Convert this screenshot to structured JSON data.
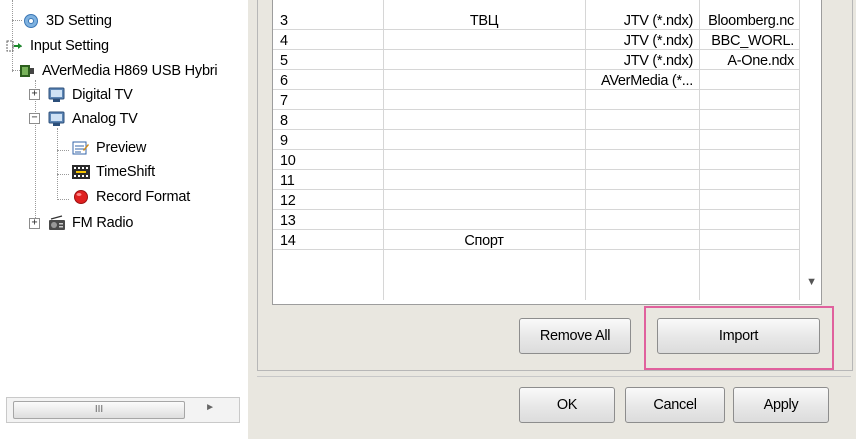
{
  "tree": {
    "items": [
      {
        "label": "3D Setting",
        "icon": "gear-icon"
      },
      {
        "label": "Input Setting",
        "icon": "input-icon"
      },
      {
        "label": "AVerMedia H869 USB Hybri",
        "icon": "tv-tuner-icon"
      },
      {
        "label": "Digital TV",
        "icon": "channel-icon",
        "expander": "+"
      },
      {
        "label": "Analog TV",
        "icon": "channel-icon",
        "expander": "−"
      },
      {
        "label": "Preview",
        "icon": "preview-icon"
      },
      {
        "label": "TimeShift",
        "icon": "timeshift-icon"
      },
      {
        "label": "Record Format",
        "icon": "record-icon"
      },
      {
        "label": "FM Radio",
        "icon": "radio-icon",
        "expander": "+"
      }
    ],
    "scrollbar_thumb": "III",
    "scroll_right_arrow": "►"
  },
  "grid": {
    "rows": [
      {
        "num": "3",
        "name": "ТВЦ",
        "format": "JTV (*.ndx)",
        "file": "Bloomberg.nc"
      },
      {
        "num": "4",
        "name": "",
        "format": "JTV (*.ndx)",
        "file": "BBC_WORL."
      },
      {
        "num": "5",
        "name": "",
        "format": "JTV (*.ndx)",
        "file": "A-One.ndx"
      },
      {
        "num": "6",
        "name": "",
        "format": "AVerMedia (*...",
        "file": ""
      },
      {
        "num": "7",
        "name": "",
        "format": "",
        "file": ""
      },
      {
        "num": "8",
        "name": "",
        "format": "",
        "file": ""
      },
      {
        "num": "9",
        "name": "",
        "format": "",
        "file": ""
      },
      {
        "num": "10",
        "name": "",
        "format": "",
        "file": ""
      },
      {
        "num": "11",
        "name": "",
        "format": "",
        "file": ""
      },
      {
        "num": "12",
        "name": "",
        "format": "",
        "file": ""
      },
      {
        "num": "13",
        "name": "",
        "format": "",
        "file": ""
      },
      {
        "num": "14",
        "name": "Спорт",
        "format": "",
        "file": ""
      }
    ],
    "scroll_down_arrow": "▼"
  },
  "buttons": {
    "remove_all": "Remove All",
    "import": "Import",
    "ok": "OK",
    "cancel": "Cancel",
    "apply": "Apply"
  },
  "colors": {
    "highlight": "#e0619d",
    "record_red": "#e02020"
  }
}
